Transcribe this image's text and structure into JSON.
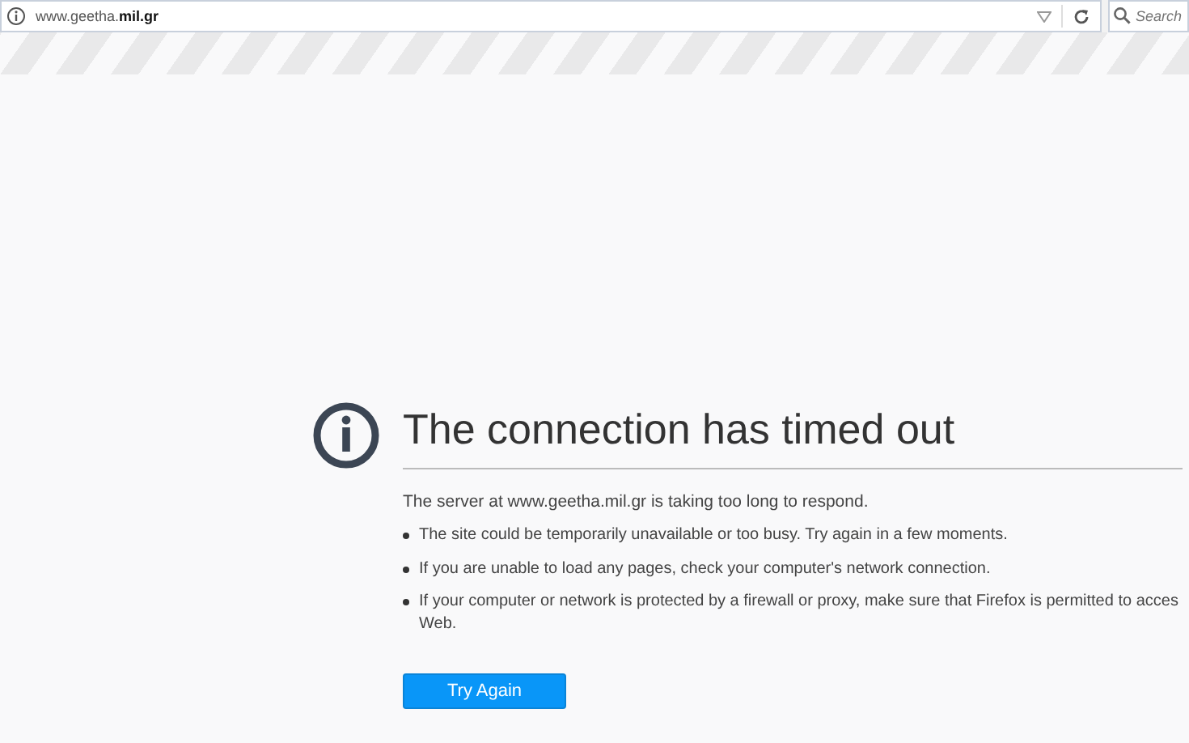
{
  "address_bar": {
    "url": "www.geetha.**mil.gr**"
  },
  "search": {
    "placeholder": "Search"
  },
  "error": {
    "title": "The connection has timed out",
    "message": "The server at www.geetha.mil.gr is taking too long to respond.",
    "bullets": [
      {
        "lines": [
          "The site could be temporarily unavailable or too busy. Try again in a few moments."
        ]
      },
      {
        "lines": [
          "If you are unable to load any pages, check your computer's network connection."
        ]
      },
      {
        "lines": [
          "If your computer or network is protected by a firewall or proxy, make sure that Firefox is permitted to acces",
          "Web."
        ]
      }
    ],
    "button": "Try Again"
  }
}
